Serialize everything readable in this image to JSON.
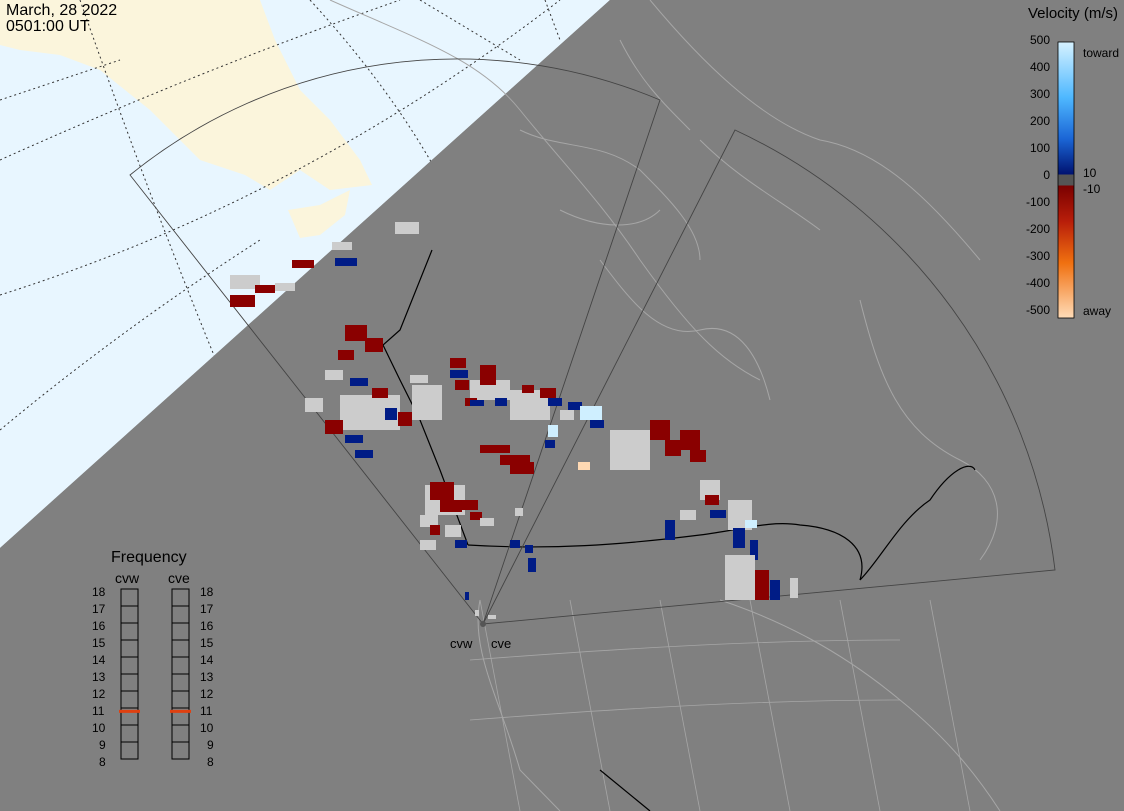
{
  "header": {
    "date": "March, 28 2022",
    "time": "0501:00 UT"
  },
  "colorbar": {
    "title": "Velocity (m/s)",
    "ticks": [
      "500",
      "400",
      "300",
      "200",
      "100",
      "0",
      "-100",
      "-200",
      "-300",
      "-400",
      "-500"
    ],
    "toward_label": "toward",
    "away_label": "away",
    "plus_label": "10",
    "minus_label": "-10",
    "colors": {
      "toward_max": "#cfefff",
      "toward_mid": "#2f9cff",
      "toward_min": "#0a1f8f",
      "away_min": "#8a0000",
      "away_mid": "#e65a00",
      "away_max": "#ffd9b3",
      "ground_scatter": "#cccccc"
    }
  },
  "frequency_panel": {
    "title": "Frequency",
    "radars": [
      "cvw",
      "cve"
    ],
    "values": [
      "18",
      "17",
      "16",
      "15",
      "14",
      "13",
      "12",
      "11",
      "10",
      "9",
      "8"
    ],
    "active_mhz": {
      "cvw": 10.8,
      "cve": 10.8
    },
    "indicator_color": "#e04010"
  },
  "map": {
    "site_labels": [
      "cvw",
      "cve"
    ],
    "colors": {
      "ocean_daylight": "#e8f6ff",
      "land_daylight": "#fbf5dc",
      "night": "#808080",
      "coastline": "#a6a6a6",
      "border": "#000000"
    }
  }
}
